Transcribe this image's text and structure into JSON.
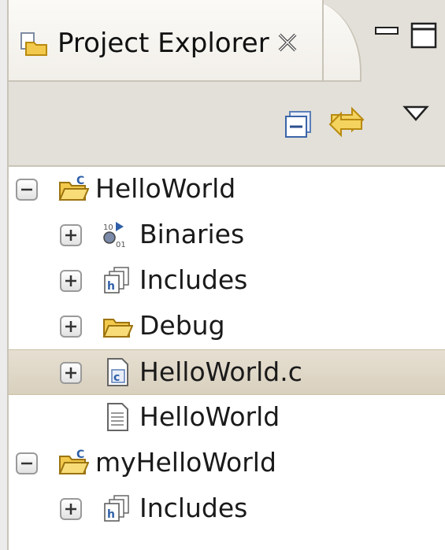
{
  "view": {
    "title": "Project Explorer",
    "icon": "project-explorer-icon",
    "close_icon": "close-icon",
    "minimize_icon": "minimize-icon",
    "maximize_icon": "maximize-icon"
  },
  "toolbar": {
    "collapse_icon": "collapse-all-icon",
    "link_icon": "link-with-editor-icon",
    "menu_icon": "view-menu-chevron-icon"
  },
  "tree": [
    {
      "label": "HelloWorld",
      "icon": "c-project-folder-icon",
      "toggle": "collapse",
      "depth": 0,
      "selected": false
    },
    {
      "label": "Binaries",
      "icon": "binaries-icon",
      "toggle": "expand",
      "depth": 1,
      "selected": false
    },
    {
      "label": "Includes",
      "icon": "includes-icon",
      "toggle": "expand",
      "depth": 1,
      "selected": false
    },
    {
      "label": "Debug",
      "icon": "folder-icon",
      "toggle": "expand",
      "depth": 1,
      "selected": false
    },
    {
      "label": "HelloWorld.c",
      "icon": "c-source-file-icon",
      "toggle": "expand",
      "depth": 1,
      "selected": true
    },
    {
      "label": "HelloWorld",
      "icon": "text-file-icon",
      "toggle": "none",
      "depth": 1,
      "selected": false
    },
    {
      "label": "myHelloWorld",
      "icon": "c-project-folder-icon",
      "toggle": "collapse",
      "depth": 0,
      "selected": false
    },
    {
      "label": "Includes",
      "icon": "includes-icon",
      "toggle": "expand",
      "depth": 1,
      "selected": false
    }
  ],
  "colors": {
    "selection": "#d9d0be",
    "header": "#e3e0d9",
    "folder": "#f2c94c",
    "c_blue": "#3d6fb5"
  }
}
